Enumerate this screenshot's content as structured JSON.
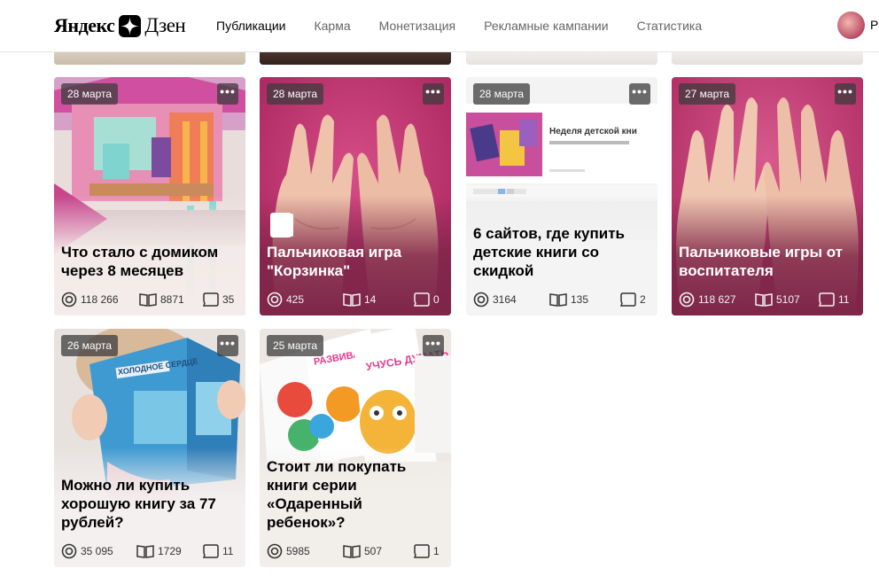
{
  "header": {
    "logo_left": "Яндекс",
    "logo_right": "Дзен",
    "nav": [
      {
        "label": "Публикации",
        "active": true
      },
      {
        "label": "Карма",
        "active": false
      },
      {
        "label": "Монетизация",
        "active": false
      },
      {
        "label": "Рекламные кампании",
        "active": false
      },
      {
        "label": "Статистика",
        "active": false
      }
    ],
    "user_initial": "Р"
  },
  "cards": [
    {
      "date": "28 марта",
      "title": "Что стало с домиком через 8 месяцев",
      "views": "118 266",
      "reads": "8871",
      "comments": "35",
      "theme": "light"
    },
    {
      "date": "28 марта",
      "title": "Пальчиковая игра \"Корзинка\"",
      "views": "425",
      "reads": "14",
      "comments": "0",
      "theme": "dark"
    },
    {
      "date": "28 марта",
      "title": "6 сайтов, где купить детские книги со скидкой",
      "views": "3164",
      "reads": "135",
      "comments": "2",
      "theme": "light"
    },
    {
      "date": "27 марта",
      "title": "Пальчиковые игры от воспитателя",
      "views": "118 627",
      "reads": "5107",
      "comments": "11",
      "theme": "dark"
    },
    {
      "date": "26 марта",
      "title": "Можно ли купить хорошую книгу за 77 рублей?",
      "views": "35 095",
      "reads": "1729",
      "comments": "11",
      "theme": "light"
    },
    {
      "date": "25 марта",
      "title": "Стоит ли покупать книги серии «Одаренный ребенок»?",
      "views": "5985",
      "reads": "507",
      "comments": "1",
      "theme": "light"
    }
  ],
  "more_label": "•••",
  "thumb_text": {
    "card3_banner": "Неделя детской кни",
    "card5_book": "ХОЛОДНОЕ СЕРДЦЕ",
    "card6_book1": "РАЗВИВАЕМ ЛОГИКУ",
    "card6_book2": "УЧУСЬ ДУМАТЬ"
  },
  "colors": {
    "pink": "#c23a73",
    "magenta_shade": "#7e2548",
    "light_shade": "#f4ecea"
  }
}
